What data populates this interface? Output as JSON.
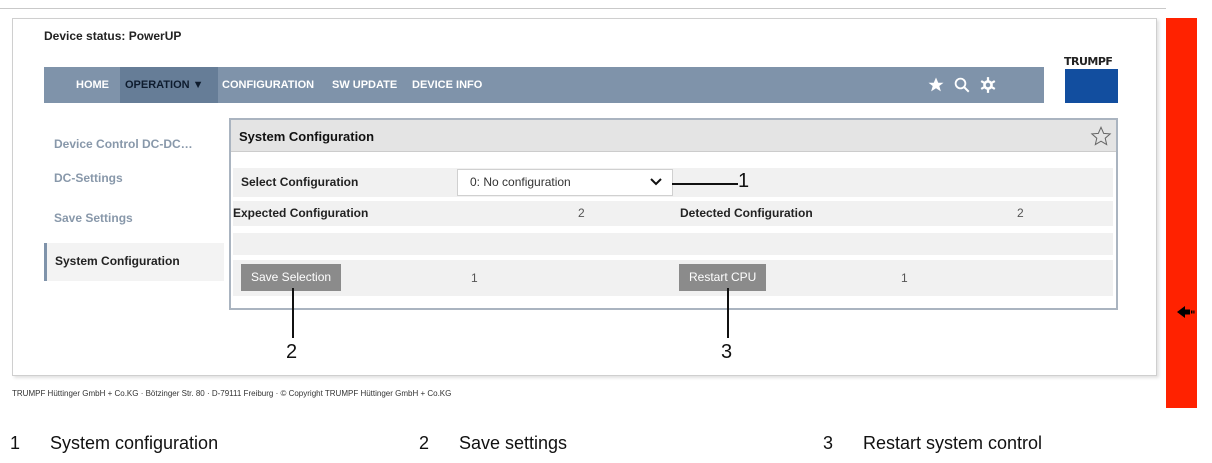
{
  "header": {
    "device_status": "Device status: PowerUP"
  },
  "nav": {
    "home": "HOME",
    "operation": "OPERATION ▼",
    "configuration": "CONFIGURATION",
    "sw_update": "SW UPDATE",
    "device_info": "DEVICE INFO",
    "icons": [
      "star-icon",
      "search-icon",
      "settings-icon"
    ]
  },
  "brand": {
    "name": "TRUMPF",
    "color": "#124e9f"
  },
  "sidebar": {
    "items": [
      {
        "label": "Device Control DC-DC…"
      },
      {
        "label": "DC-Settings"
      },
      {
        "label": "Save Settings"
      },
      {
        "label": "System Configuration",
        "active": true
      }
    ]
  },
  "panel": {
    "title": "System Configuration",
    "select_label": "Select Configuration",
    "select_value": "0: No configuration",
    "expected_label": "Expected Configuration",
    "expected_value": "2",
    "detected_label": "Detected Configuration",
    "detected_value": "2",
    "save_button": "Save Selection",
    "save_value": "1",
    "restart_button": "Restart CPU",
    "restart_value": "1"
  },
  "callouts": {
    "c1": "1",
    "c2": "2",
    "c3": "3"
  },
  "footer": {
    "text": "TRUMPF Hüttinger GmbH + Co.KG · Bötzinger Str. 80 · D-79111 Freiburg · © Copyright TRUMPF Hüttinger GmbH + Co.KG"
  },
  "legend": [
    {
      "num": "1",
      "text": "System configuration"
    },
    {
      "num": "2",
      "text": "Save settings"
    },
    {
      "num": "3",
      "text": "Restart system control"
    }
  ],
  "colors": {
    "nav_bg": "#7f93aa",
    "nav_active": "#667d97",
    "side_bar": "#ff2200",
    "button": "#8b8b8b"
  }
}
